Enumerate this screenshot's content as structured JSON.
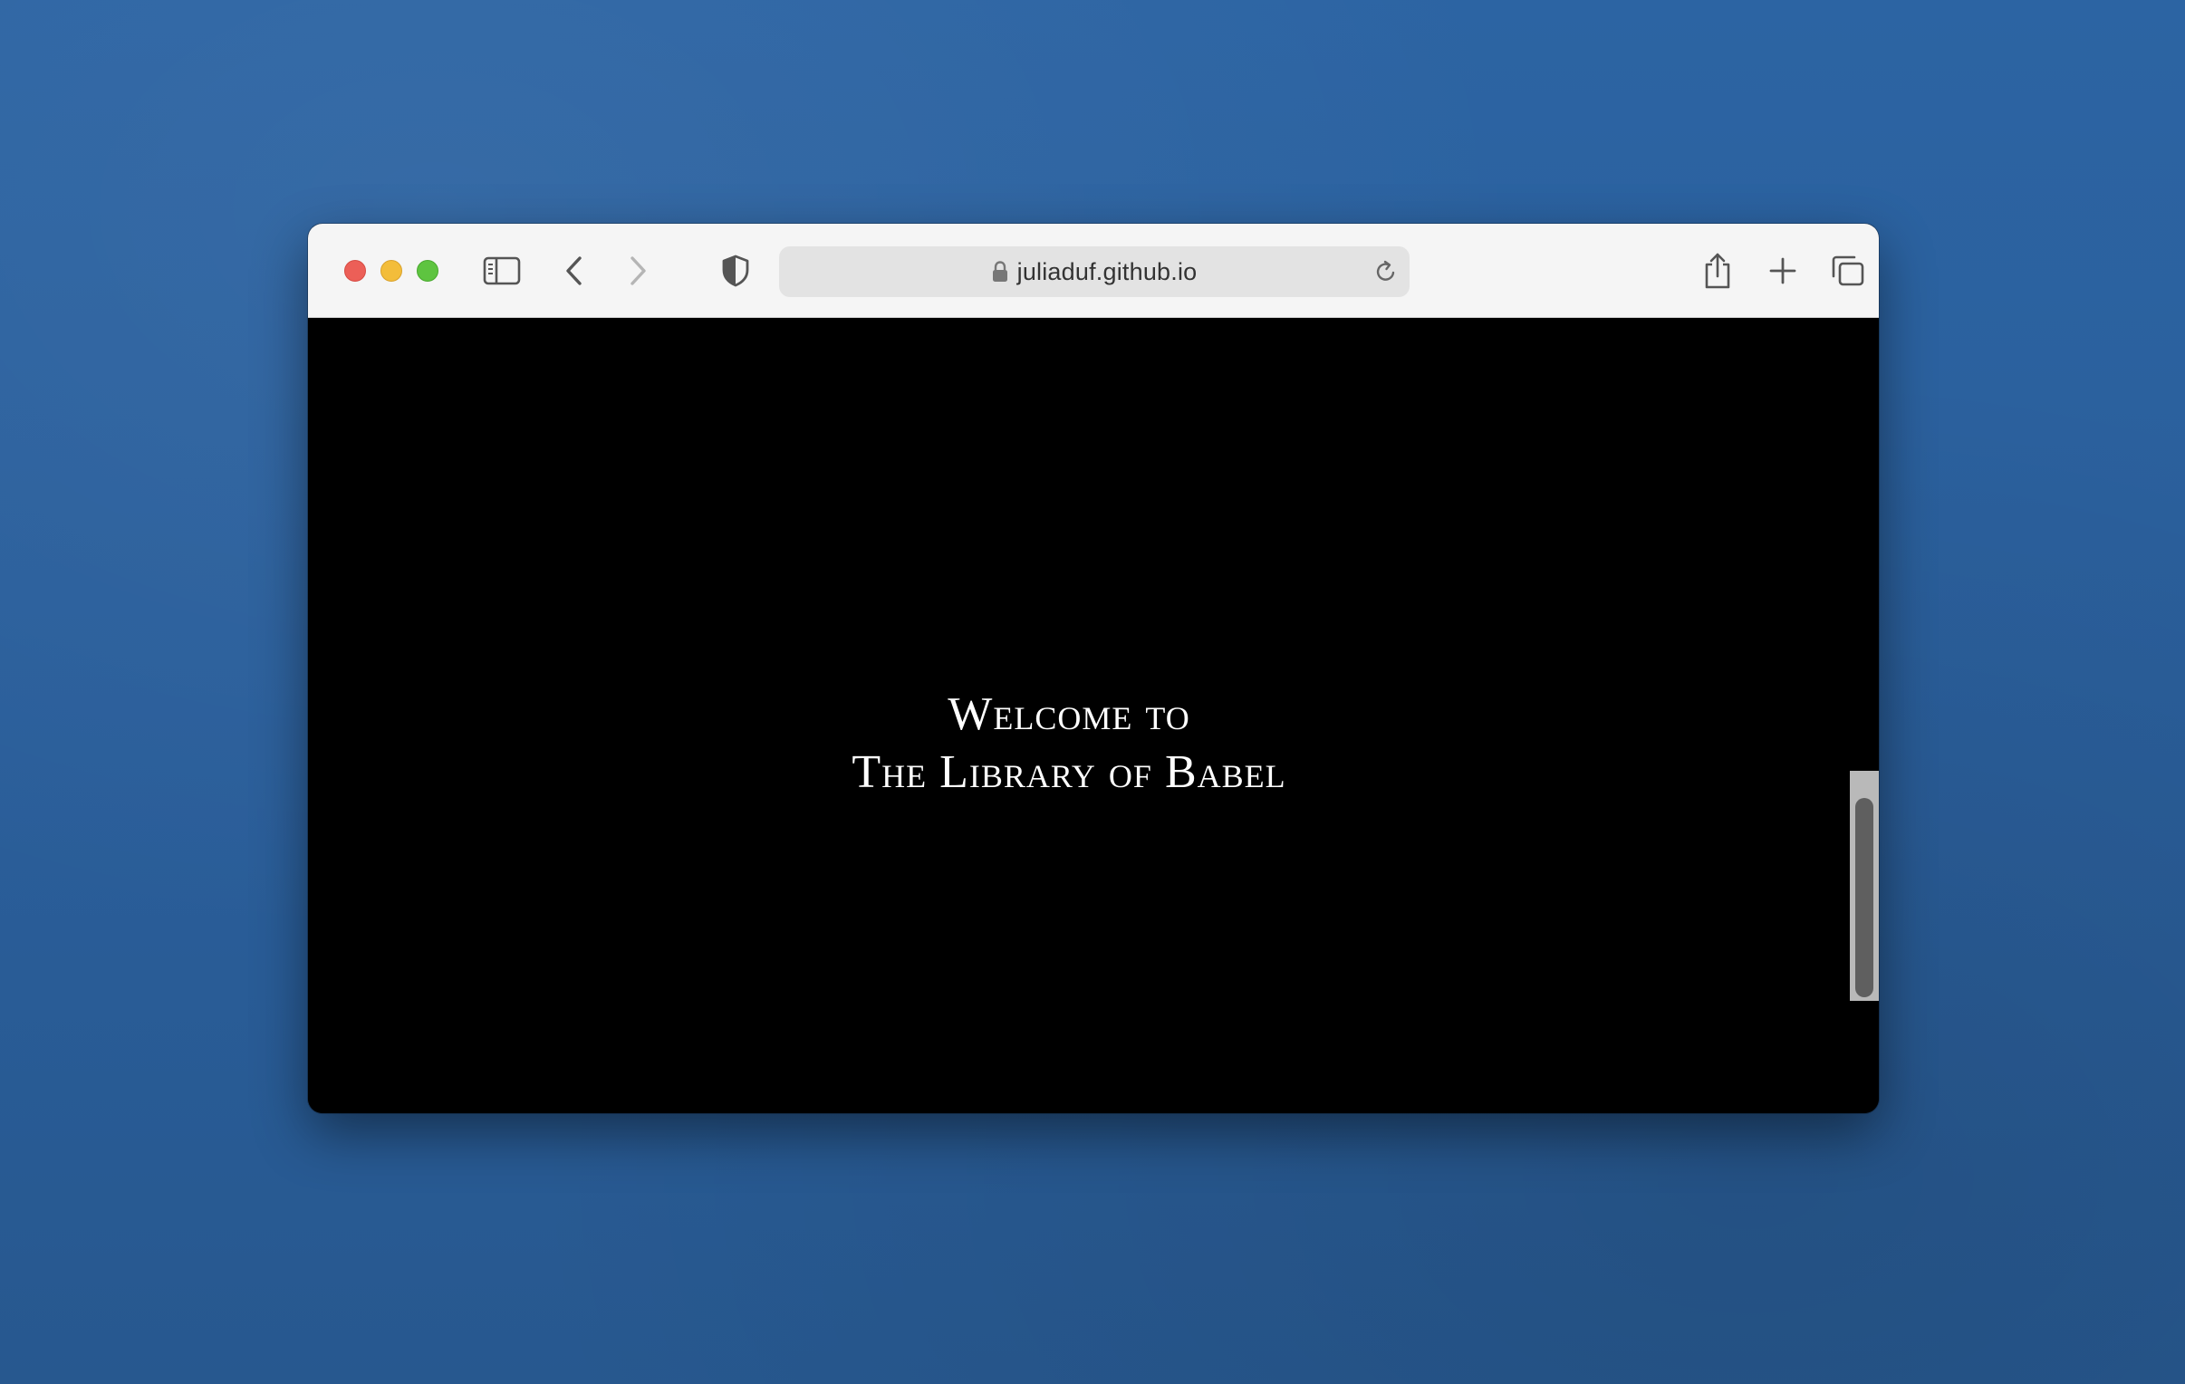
{
  "browser": {
    "address_bar": {
      "url": "juliaduf.github.io"
    },
    "toolbar_icons": [
      "sidebar-icon",
      "back-icon",
      "forward-icon",
      "privacy-shield-icon",
      "lock-icon",
      "reload-icon",
      "share-icon",
      "new-tab-icon",
      "tab-overview-icon"
    ]
  },
  "page": {
    "heading_line_1": "Welcome to",
    "heading_line_2": "The Library of Babel",
    "background_color": "#000000",
    "text_color": "#ffffff"
  },
  "colors": {
    "desktop": "#2a5f9c",
    "close": "#ec5f57",
    "minimize": "#f3bd3a",
    "maximize": "#5ec440"
  }
}
